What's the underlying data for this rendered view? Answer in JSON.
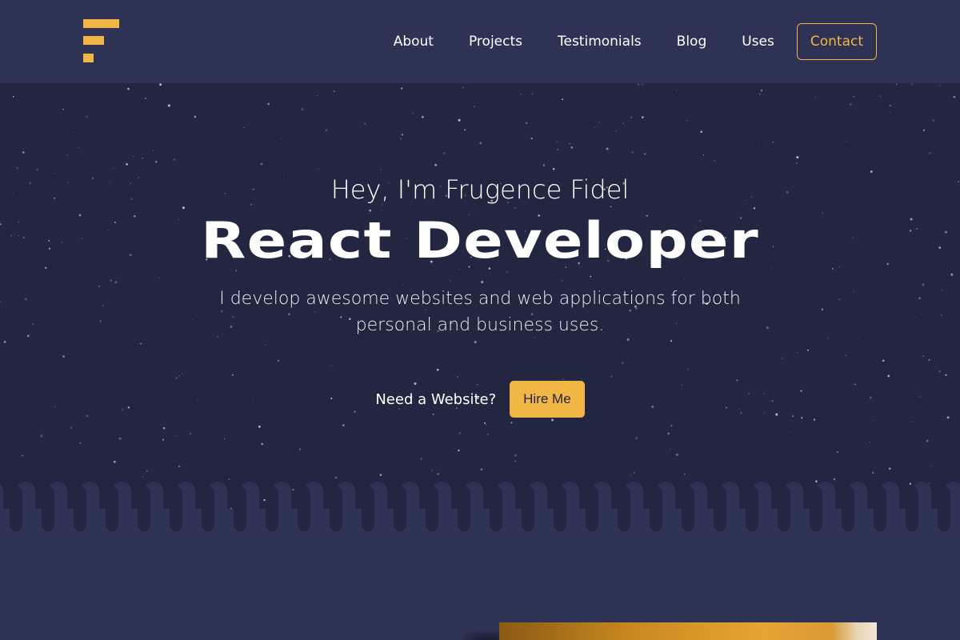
{
  "nav": {
    "logo_name": "F-logo",
    "links": [
      "About",
      "Projects",
      "Testimonials",
      "Blog",
      "Uses"
    ],
    "contact_label": "Contact"
  },
  "hero": {
    "greeting": "Hey, I'm Frugence Fidel",
    "role": "React Developer",
    "tagline": "I develop awesome websites and web applications for both personal and business uses.",
    "cta_text": "Need a Website?",
    "hire_label": "Hire Me"
  },
  "colors": {
    "accent": "#f2b644",
    "nav_bg": "#2e3254",
    "hero_bg": "#232640"
  }
}
